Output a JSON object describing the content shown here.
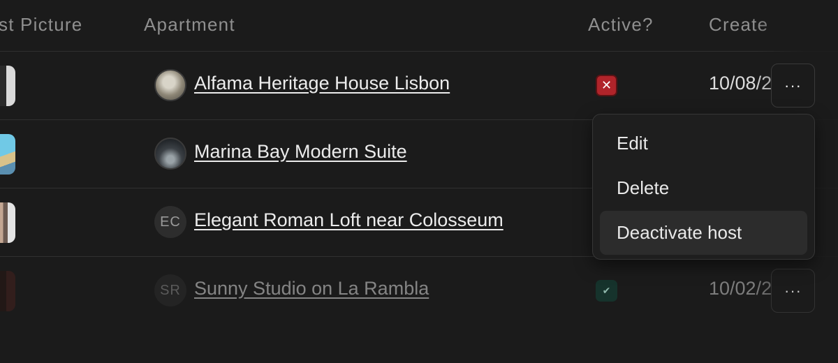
{
  "table": {
    "columns": [
      "st Picture",
      "Apartment",
      "Active?",
      "Create"
    ],
    "rows": [
      {
        "apartment": "Alfama Heritage House Lisbon",
        "avatar_initials": "",
        "active": false,
        "active_icon": "close-icon",
        "created": "10/08/2"
      },
      {
        "apartment": "Marina Bay Modern Suite",
        "avatar_initials": "",
        "active": null,
        "created": ""
      },
      {
        "apartment": "Elegant Roman Loft near Colosseum",
        "avatar_initials": "EC",
        "active": null,
        "created": ""
      },
      {
        "apartment": "Sunny Studio on La Rambla",
        "avatar_initials": "SR",
        "active": true,
        "active_icon": "check-icon",
        "created": "10/02/2"
      }
    ],
    "row_menu_label": "···"
  },
  "context_menu": {
    "items": [
      "Edit",
      "Delete",
      "Deactivate host"
    ],
    "highlighted": "Deactivate host"
  },
  "colors": {
    "background": "#1b1b1b",
    "inactive_badge": "#b0242a",
    "active_badge": "#16332c"
  }
}
